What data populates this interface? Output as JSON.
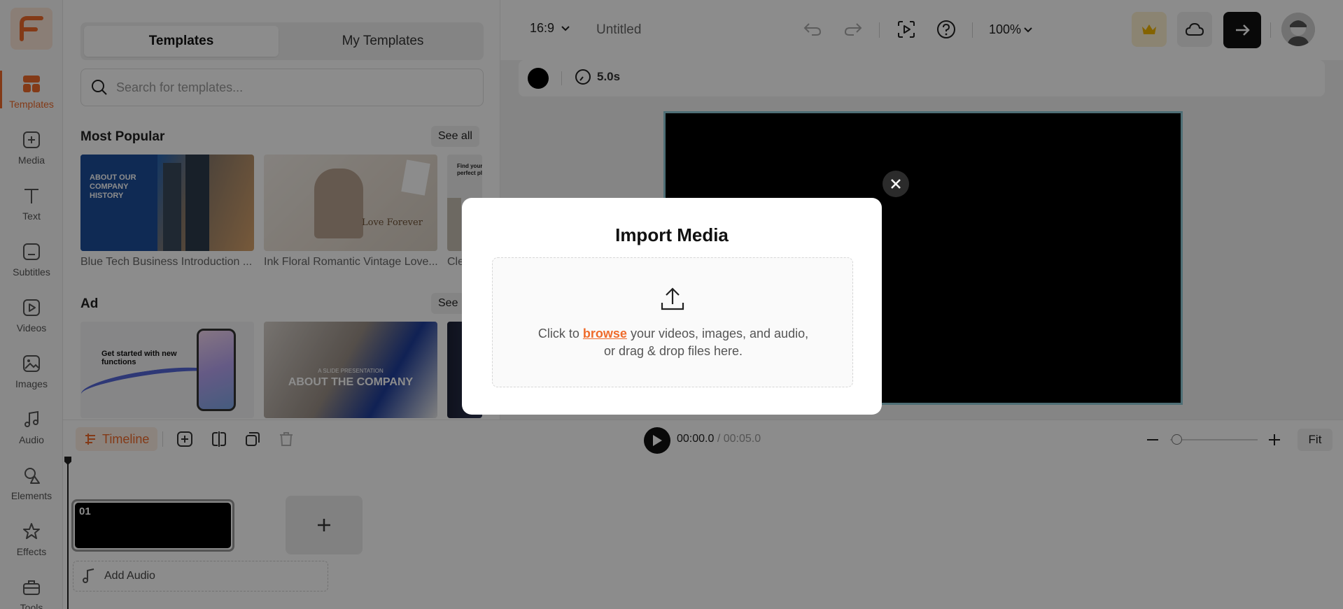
{
  "rail": {
    "items": [
      {
        "label": "Templates"
      },
      {
        "label": "Media"
      },
      {
        "label": "Text"
      },
      {
        "label": "Subtitles"
      },
      {
        "label": "Videos"
      },
      {
        "label": "Images"
      },
      {
        "label": "Audio"
      },
      {
        "label": "Elements"
      },
      {
        "label": "Effects"
      },
      {
        "label": "Tools"
      }
    ]
  },
  "panel": {
    "tabs": [
      {
        "label": "Templates"
      },
      {
        "label": "My Templates"
      }
    ],
    "search_placeholder": "Search for templates...",
    "sections": [
      {
        "title": "Most Popular",
        "see_all": "See all",
        "items": [
          {
            "caption": "Blue Tech Business Introduction ...",
            "thumb_text": "ABOUT OUR COMPANY HISTORY"
          },
          {
            "caption": "Ink Floral Romantic Vintage Love...",
            "thumb_text": "Love Forever"
          },
          {
            "caption": "Cle",
            "thumb_text": "Find your perfect pl"
          }
        ]
      },
      {
        "title": "Ad",
        "see_all": "See",
        "items": [
          {
            "thumb_text": "Get started with new functions"
          },
          {
            "thumb_text_small": "A SLIDE PRESENTATION",
            "thumb_text": "ABOUT THE COMPANY"
          },
          {}
        ]
      }
    ]
  },
  "topbar": {
    "ratio": "16:9",
    "doc_title": "Untitled",
    "zoom": "100%"
  },
  "toolstrip": {
    "color": "#000000",
    "duration": "5.0s"
  },
  "timeline": {
    "label": "Timeline",
    "current_time": "00:00.0",
    "total_time": "/ 00:05.0",
    "fit_label": "Fit",
    "scene_number": "01",
    "add_audio_label": "Add Audio"
  },
  "modal": {
    "title": "Import Media",
    "line1_prefix": "Click to ",
    "browse": "browse",
    "line1_suffix": " your videos, images, and audio,",
    "line2": "or drag & drop files here."
  },
  "colors": {
    "accent": "#ef6b2b",
    "stage_border": "#8ec8d6"
  }
}
